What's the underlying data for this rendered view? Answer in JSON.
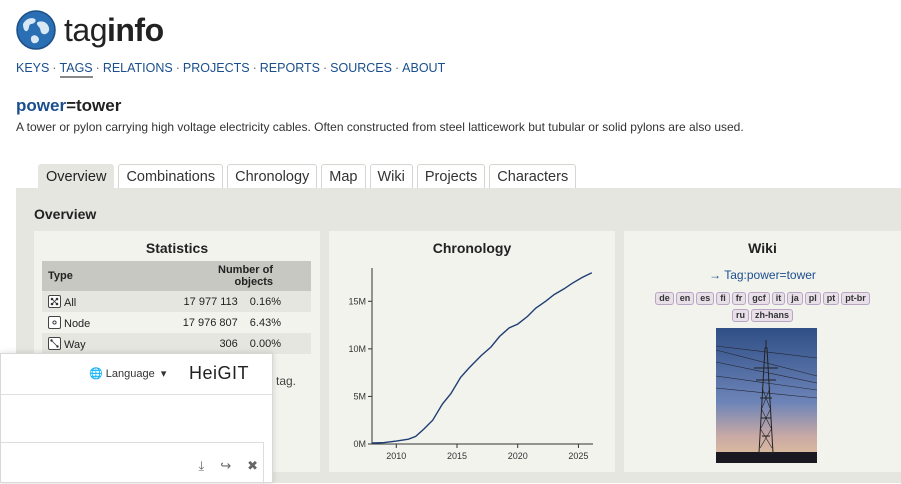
{
  "header": {
    "brand_part1": "tag",
    "brand_part2": "info"
  },
  "nav": {
    "items": [
      "KEYS",
      "TAGS",
      "RELATIONS",
      "PROJECTS",
      "REPORTS",
      "SOURCES",
      "ABOUT"
    ],
    "active": "TAGS"
  },
  "tag": {
    "key": "power",
    "eq": "=",
    "value": "tower",
    "description": "A tower or pylon carrying high voltage electricity cables. Often constructed from steel latticework but tubular or solid pylons are also used."
  },
  "tabs": [
    "Overview",
    "Combinations",
    "Chronology",
    "Map",
    "Wiki",
    "Projects",
    "Characters"
  ],
  "panel": {
    "title": "Overview"
  },
  "statistics": {
    "title": "Statistics",
    "col_type": "Type",
    "col_count": "Number of objects",
    "rows": [
      {
        "type": "All",
        "count": "17 977 113",
        "pct": "0.16%"
      },
      {
        "type": "Node",
        "count": "17 976 807",
        "pct": "6.43%"
      },
      {
        "type": "Way",
        "count": "306",
        "pct": "0.00%"
      }
    ],
    "note_fragment": "is tag."
  },
  "chronology": {
    "title": "Chronology"
  },
  "chart_data": {
    "type": "line",
    "title": "Chronology",
    "xlabel": "",
    "ylabel": "",
    "x_ticks": [
      "2010",
      "2015",
      "2020",
      "2025"
    ],
    "y_ticks": [
      "0M",
      "5M",
      "10M",
      "15M"
    ],
    "xlim": [
      2008.0,
      2026.2
    ],
    "ylim": [
      0,
      18.5
    ],
    "series": [
      {
        "x": [
          2008.0,
          2009.0,
          2010.0,
          2011.0,
          2011.6,
          2012.3,
          2013.0,
          2013.8,
          2014.5,
          2015.3,
          2016.0,
          2017.0,
          2017.8,
          2018.5,
          2019.3,
          2020.0,
          2020.8,
          2021.5,
          2022.3,
          2023.0,
          2023.8,
          2024.5,
          2025.3,
          2026.1
        ],
        "y": [
          0.1,
          0.15,
          0.3,
          0.5,
          0.8,
          1.6,
          2.5,
          4.2,
          5.3,
          7.0,
          8.0,
          9.3,
          10.2,
          11.3,
          12.2,
          12.6,
          13.4,
          14.3,
          15.0,
          15.7,
          16.3,
          16.9,
          17.5,
          18.0
        ]
      }
    ],
    "line_color": "#1f3e73"
  },
  "wiki": {
    "title": "Wiki",
    "link": "→ Tag:power=tower",
    "languages": [
      "de",
      "en",
      "es",
      "fi",
      "fr",
      "gcf",
      "it",
      "ja",
      "pl",
      "pt",
      "pt-br",
      "ru",
      "zh-hans"
    ]
  },
  "overlay": {
    "language_label": "Language",
    "brand": "HeiGIT"
  },
  "colors": {
    "link": "#1a4e8c",
    "panel": "#e6e6e0",
    "box": "#f3f3ee",
    "lang_bg": "#e8dfe9"
  }
}
